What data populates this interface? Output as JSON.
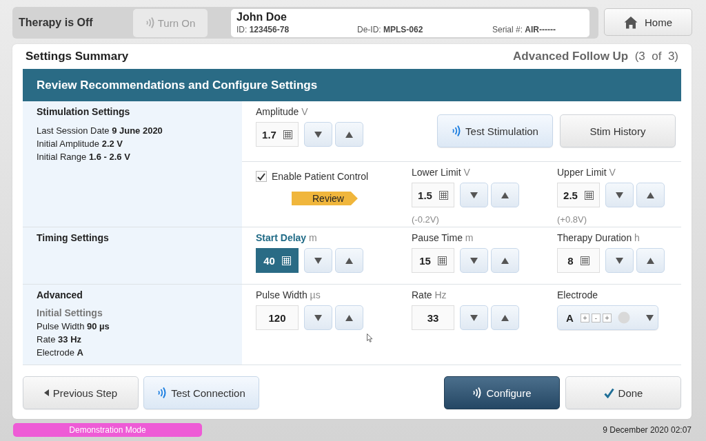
{
  "status": {
    "label": "Therapy is Off",
    "turn_on": {
      "label": "Turn On",
      "disabled": true
    }
  },
  "patient": {
    "name": "John Doe",
    "fields": [
      {
        "label": "ID:",
        "value": "123456-78"
      },
      {
        "label": "De-ID:",
        "value": "MPLS-062"
      },
      {
        "label": "Serial #:",
        "value": "AIR------"
      }
    ]
  },
  "home": {
    "label": "Home"
  },
  "header": {
    "title": "Settings Summary",
    "step": "Advanced Follow Up",
    "count": "(3  of  3)"
  },
  "banner": "Review Recommendations and Configure Settings",
  "sections": [
    {
      "heading": "Stimulation Settings",
      "info": [
        "Last Session Date  **9 June 2020**",
        "Initial Amplitude **2.2 V**",
        "Initial Range **1.6  -  2.6 V**"
      ],
      "rows": [
        {
          "cells": [
            [
              {
                "kind": "spinner",
                "label": "Amplitude",
                "unit": "V",
                "value": "1.7",
                "active": false,
                "keypad": true
              }
            ],
            [
              {
                "kind": "button",
                "button": {
                  "kind": "wireless",
                  "label": "Test Stimulation"
                }
              }
            ],
            [
              {
                "kind": "button",
                "button": {
                  "kind": "plain",
                  "label": "Stim History"
                }
              }
            ]
          ]
        },
        {
          "cells": [
            [
              {
                "kind": "checkbox",
                "label": "Enable Patient Control",
                "checked": true
              },
              {
                "kind": "tag",
                "label": "Review"
              }
            ],
            [
              {
                "kind": "spinner",
                "label": "Lower Limit",
                "unit": "V",
                "value": "1.5",
                "active": false,
                "keypad": true,
                "delta": "(-0.2V)"
              }
            ],
            [
              {
                "kind": "spinner",
                "label": "Upper Limit",
                "unit": "V",
                "value": "2.5",
                "active": false,
                "keypad": true,
                "delta": "(+0.8V)"
              }
            ]
          ]
        }
      ]
    },
    {
      "heading": "Timing Settings",
      "rows": [
        {
          "cells": [
            [
              {
                "kind": "spinner",
                "label": "Start Delay",
                "unit": "m",
                "value": "40",
                "active": true,
                "keypad": true
              }
            ],
            [
              {
                "kind": "spinner",
                "label": "Pause Time",
                "unit": "m",
                "value": "15",
                "active": false,
                "keypad": true
              }
            ],
            [
              {
                "kind": "spinner",
                "label": "Therapy Duration",
                "unit": "h",
                "value": "8",
                "active": false,
                "keypad": true
              }
            ]
          ]
        }
      ]
    },
    {
      "heading": "Advanced",
      "subheading": "Initial Settings",
      "info": [
        "Pulse Width **90 µs**",
        "Rate **33 Hz**",
        "Electrode **A**"
      ],
      "rows": [
        {
          "cells": [
            [
              {
                "kind": "spinner",
                "label": "Pulse Width",
                "unit": "µs",
                "value": "120",
                "active": false,
                "keypad": false
              }
            ],
            [
              {
                "kind": "spinner",
                "label": "Rate",
                "unit": "Hz",
                "value": "33",
                "active": false,
                "keypad": false
              }
            ],
            [
              {
                "kind": "electrode",
                "label": "Electrode",
                "value": "A",
                "contacts": [
                  "+",
                  "-",
                  "+"
                ]
              }
            ]
          ]
        }
      ]
    }
  ],
  "footer_buttons": {
    "left": [
      {
        "kind": "back",
        "label": "Previous Step"
      },
      {
        "kind": "wireless",
        "label": "Test Connection"
      }
    ],
    "right": [
      {
        "kind": "submit",
        "label": "Configure"
      },
      {
        "kind": "confirm",
        "label": "Done"
      }
    ]
  },
  "status_bar": {
    "mode": "Demonstration Mode",
    "datetime": "9 December 2020 02:07"
  }
}
